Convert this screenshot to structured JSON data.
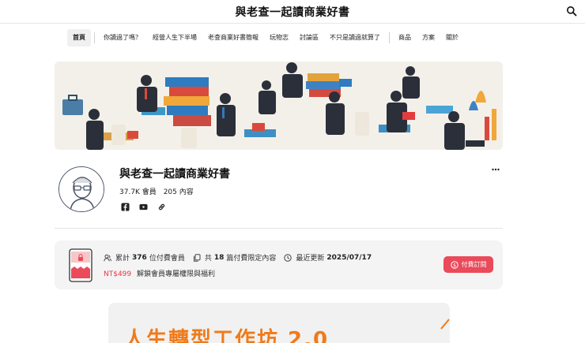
{
  "site": {
    "title": "與老查一起讀商業好書"
  },
  "nav": {
    "items": [
      {
        "label": "首頁",
        "active": true
      },
      {
        "label": "你讀過了嗎？"
      },
      {
        "label": "經營人生下半場"
      },
      {
        "label": "老查商業好書簡報"
      },
      {
        "label": "玩物志"
      },
      {
        "label": "討論區"
      },
      {
        "label": "不只是讀過就算了"
      },
      {
        "label": "商品"
      },
      {
        "label": "方案"
      },
      {
        "label": "關於"
      }
    ]
  },
  "profile": {
    "name": "與老查一起讀商業好書",
    "members": "37.7K 會員",
    "contents": "205 內容"
  },
  "subscription": {
    "paid_prefix": "累計",
    "paid_count": "376",
    "paid_suffix": "位付費會員",
    "exclusive_prefix": "共",
    "exclusive_count": "18",
    "exclusive_suffix": "篇付費限定內容",
    "updated_prefix": "最近更新",
    "updated_date": "2025/07/17",
    "price": "NT$499",
    "price_desc": "解鎖會員專屬權限與福利",
    "button_label": "付費訂閱"
  },
  "post": {
    "title": "人生轉型工作坊 2.0"
  },
  "colors": {
    "accent": "#ea4a5a",
    "price": "#e63946",
    "post_title": "#f07a1a"
  }
}
